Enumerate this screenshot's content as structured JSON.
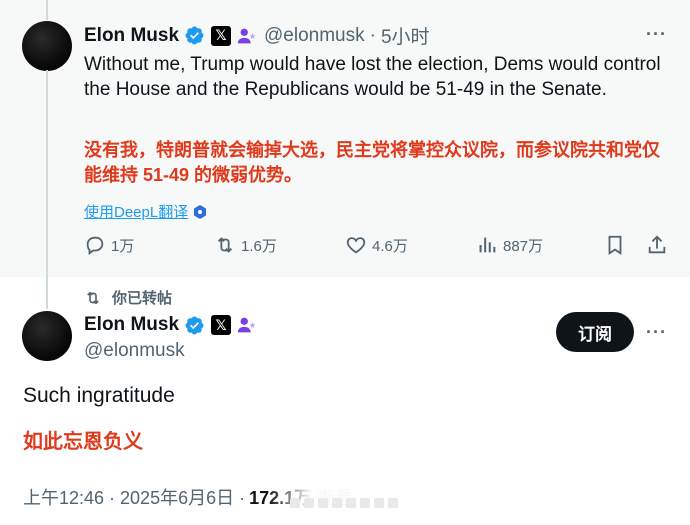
{
  "tweet1": {
    "author_name": "Elon Musk",
    "x_badge": "𝕏",
    "handle": "@elonmusk",
    "separator": "·",
    "time": "5小时",
    "more": "···",
    "text_en": "Without me, Trump would have lost the election, Dems would control the House and the Republicans would be 51-49 in the Senate.",
    "text_zh": "没有我，特朗普就会输掉大选，民主党将掌控众议院，而参议院共和党仅能维持 51-49 的微弱优势。",
    "translate_label": "使用DeepL翻译",
    "actions": {
      "reply_count": "1万",
      "repost_count": "1.6万",
      "like_count": "4.6万",
      "views_count": "887万"
    }
  },
  "repost_label": "你已转帖",
  "tweet2": {
    "author_name": "Elon Musk",
    "x_badge": "𝕏",
    "handle": "@elonmusk",
    "subscribe_label": "订阅",
    "more": "···",
    "text_en": "Such ingratitude",
    "text_zh": "如此忘恩负义",
    "timestamp": "上午12:46 · 2025年6月6日 ·",
    "views": "172.1万",
    "views_label": "查看"
  },
  "colors": {
    "verified": "#1d9bf0",
    "link": "#1d9bf0",
    "translation": "#e03a1c",
    "muted": "#536471",
    "affiliate": "#7b3fe4"
  },
  "icons": [
    "verified-badge-icon",
    "x-badge-icon",
    "affiliate-person-icon",
    "reply-icon",
    "repost-icon",
    "like-icon",
    "views-icon",
    "bookmark-icon",
    "share-icon",
    "deepl-icon"
  ]
}
